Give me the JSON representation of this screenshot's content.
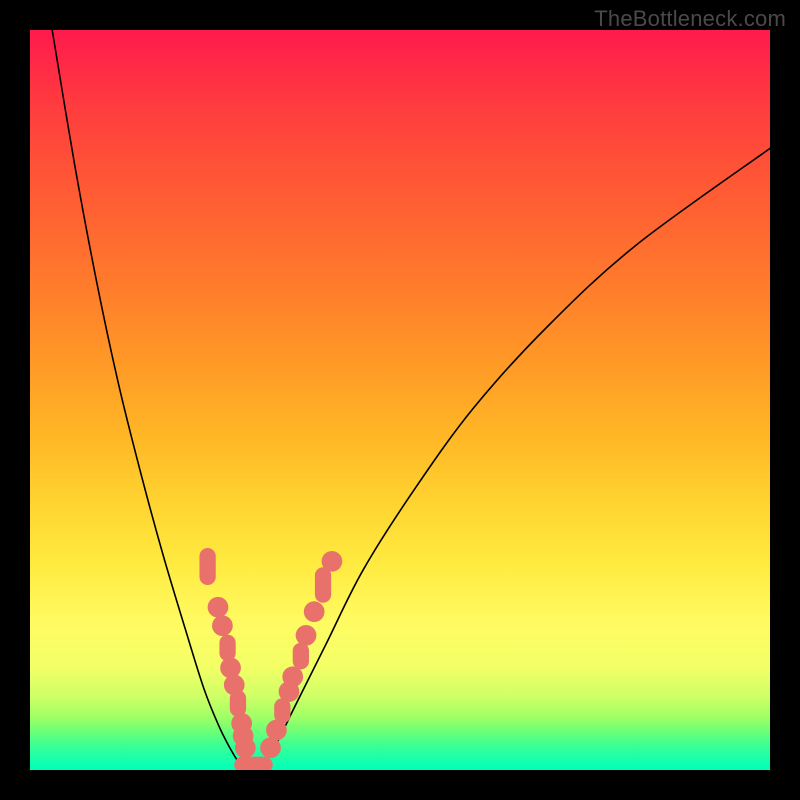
{
  "watermark": "TheBottleneck.com",
  "chart_data": {
    "type": "line",
    "title": "",
    "xlabel": "",
    "ylabel": "",
    "xlim": [
      0,
      100
    ],
    "ylim": [
      0,
      100
    ],
    "grid": false,
    "legend": false,
    "background_gradient": {
      "direction": "vertical",
      "stops": [
        {
          "pos": 0,
          "color": "#ff1a4d"
        },
        {
          "pos": 22,
          "color": "#ff5b34"
        },
        {
          "pos": 45,
          "color": "#ff9926"
        },
        {
          "pos": 64,
          "color": "#ffd430"
        },
        {
          "pos": 80,
          "color": "#fffb62"
        },
        {
          "pos": 93,
          "color": "#9dff66"
        },
        {
          "pos": 100,
          "color": "#00ffbb"
        }
      ]
    },
    "series": [
      {
        "name": "left_curve",
        "x": [
          3,
          6,
          9,
          12,
          15,
          18,
          21,
          23.5,
          25.5,
          27,
          28.2,
          29
        ],
        "y": [
          100,
          82,
          66,
          52,
          40,
          29,
          19,
          11,
          6,
          3,
          1,
          0
        ],
        "stroke": "#000000",
        "stroke_width": 1.6
      },
      {
        "name": "right_curve",
        "x": [
          31,
          33,
          36,
          40,
          45,
          52,
          60,
          70,
          82,
          100
        ],
        "y": [
          0,
          3,
          9,
          17,
          27,
          38,
          49,
          60,
          71,
          84
        ],
        "stroke": "#000000",
        "stroke_width": 1.6
      },
      {
        "name": "data_markers_left_branch",
        "type": "scatter",
        "color": "#e9716b",
        "points": [
          {
            "x": 24.0,
            "y": 27.5,
            "shape": "pill-v",
            "w": 2.2,
            "h": 5.0
          },
          {
            "x": 25.4,
            "y": 22.0,
            "shape": "dot",
            "r": 1.4
          },
          {
            "x": 26.0,
            "y": 19.5,
            "shape": "dot",
            "r": 1.4
          },
          {
            "x": 26.7,
            "y": 16.5,
            "shape": "pill-v",
            "w": 2.2,
            "h": 3.6
          },
          {
            "x": 27.1,
            "y": 13.8,
            "shape": "dot",
            "r": 1.4
          },
          {
            "x": 27.6,
            "y": 11.5,
            "shape": "dot",
            "r": 1.4
          },
          {
            "x": 28.1,
            "y": 9.0,
            "shape": "pill-v",
            "w": 2.2,
            "h": 3.6
          },
          {
            "x": 28.6,
            "y": 6.3,
            "shape": "dot",
            "r": 1.4
          },
          {
            "x": 28.8,
            "y": 4.6,
            "shape": "dot",
            "r": 1.4
          },
          {
            "x": 29.1,
            "y": 3.0,
            "shape": "dot",
            "r": 1.4
          }
        ]
      },
      {
        "name": "data_markers_right_branch",
        "type": "scatter",
        "color": "#e9716b",
        "points": [
          {
            "x": 32.5,
            "y": 3.0,
            "shape": "dot",
            "r": 1.4
          },
          {
            "x": 33.3,
            "y": 5.4,
            "shape": "dot",
            "r": 1.4
          },
          {
            "x": 34.1,
            "y": 8.0,
            "shape": "pill-v",
            "w": 2.2,
            "h": 3.4
          },
          {
            "x": 35.0,
            "y": 10.6,
            "shape": "dot",
            "r": 1.4
          },
          {
            "x": 35.5,
            "y": 12.6,
            "shape": "dot",
            "r": 1.4
          },
          {
            "x": 36.6,
            "y": 15.4,
            "shape": "pill-v",
            "w": 2.2,
            "h": 3.6
          },
          {
            "x": 37.3,
            "y": 18.2,
            "shape": "dot",
            "r": 1.4
          },
          {
            "x": 38.4,
            "y": 21.4,
            "shape": "dot",
            "r": 1.4
          },
          {
            "x": 39.6,
            "y": 25.0,
            "shape": "pill-v",
            "w": 2.2,
            "h": 4.8
          },
          {
            "x": 40.8,
            "y": 28.2,
            "shape": "dot",
            "r": 1.4
          }
        ]
      },
      {
        "name": "data_markers_bottom_bar",
        "type": "scatter",
        "color": "#e9716b",
        "points": [
          {
            "x": 30.2,
            "y": 0.7,
            "shape": "pill-h",
            "w": 5.2,
            "h": 2.2
          }
        ]
      }
    ]
  }
}
